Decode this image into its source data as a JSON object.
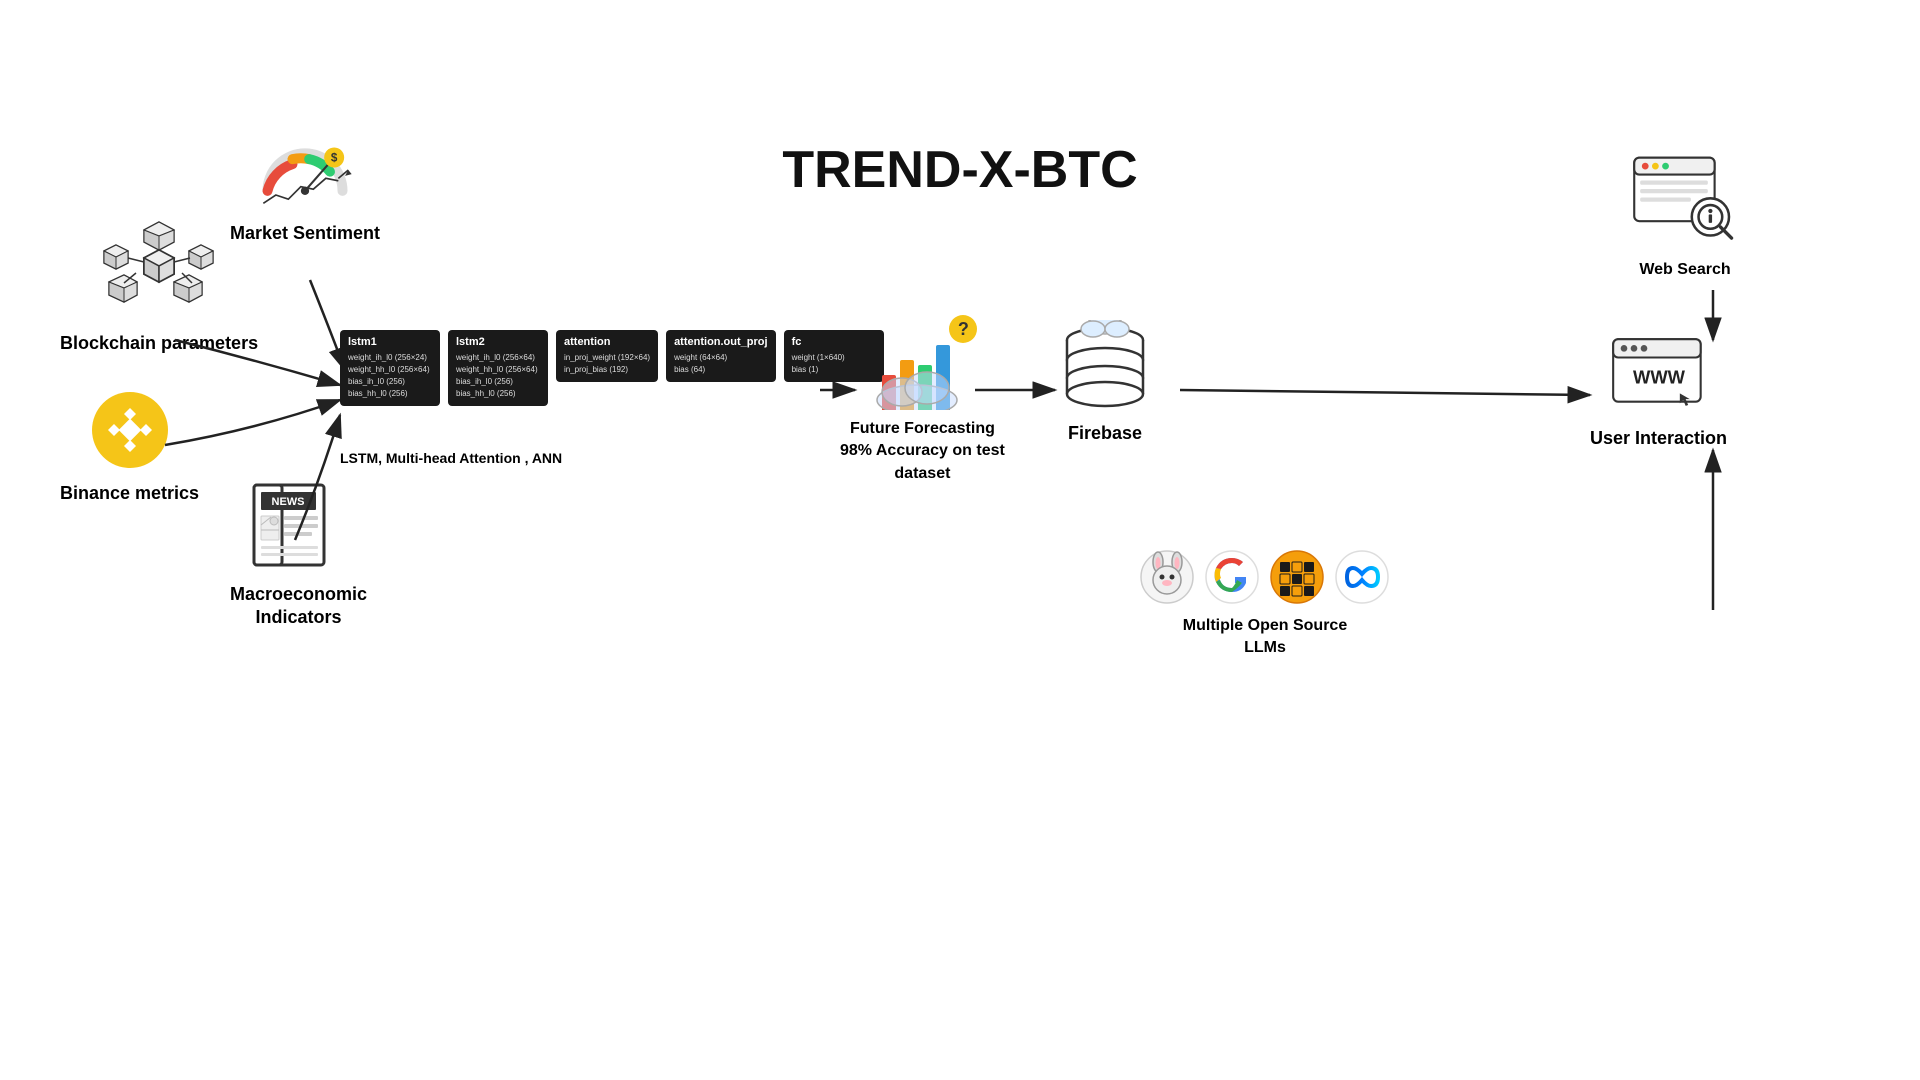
{
  "title": "TREND-X-BTC",
  "sections": {
    "blockchain": {
      "label": "Blockchain parameters"
    },
    "market_sentiment": {
      "label": "Market Sentiment"
    },
    "binance": {
      "label": "Binance metrics"
    },
    "macro": {
      "label": "Macroeconomic\nIndicators"
    },
    "model": {
      "label": "LSTM, Multi-head Attention , ANN",
      "boxes": [
        {
          "title": "lstm1",
          "rows": [
            "weight_ih_l0  (256×24)",
            "weight_hh_l0  (256×64)",
            "bias_ih_l0  (256)",
            "bias_hh_l0  (256)"
          ]
        },
        {
          "title": "lstm2",
          "rows": [
            "weight_ih_l0  (256×64)",
            "weight_hh_l0  (256×64)",
            "bias_ih_l0  (256)",
            "bias_hh_l0  (256)"
          ]
        },
        {
          "title": "attention",
          "rows": [
            "in_proj_weight  (192×64)",
            "in_proj_bias  (192)"
          ]
        },
        {
          "title": "attention.out_proj",
          "rows": [
            "weight  (64×64)",
            "bias  (64)"
          ]
        },
        {
          "title": "fc",
          "rows": [
            "weight  (1×640)",
            "bias  (1)"
          ]
        }
      ]
    },
    "forecast": {
      "label": "Future Forecasting\n98% Accuracy on test\ndataset"
    },
    "firebase": {
      "label": "Firebase"
    },
    "web_search": {
      "label": "Web Search"
    },
    "user_interaction": {
      "label": "User Interaction"
    },
    "llms": {
      "label": "Multiple Open Source\nLLMs"
    }
  }
}
